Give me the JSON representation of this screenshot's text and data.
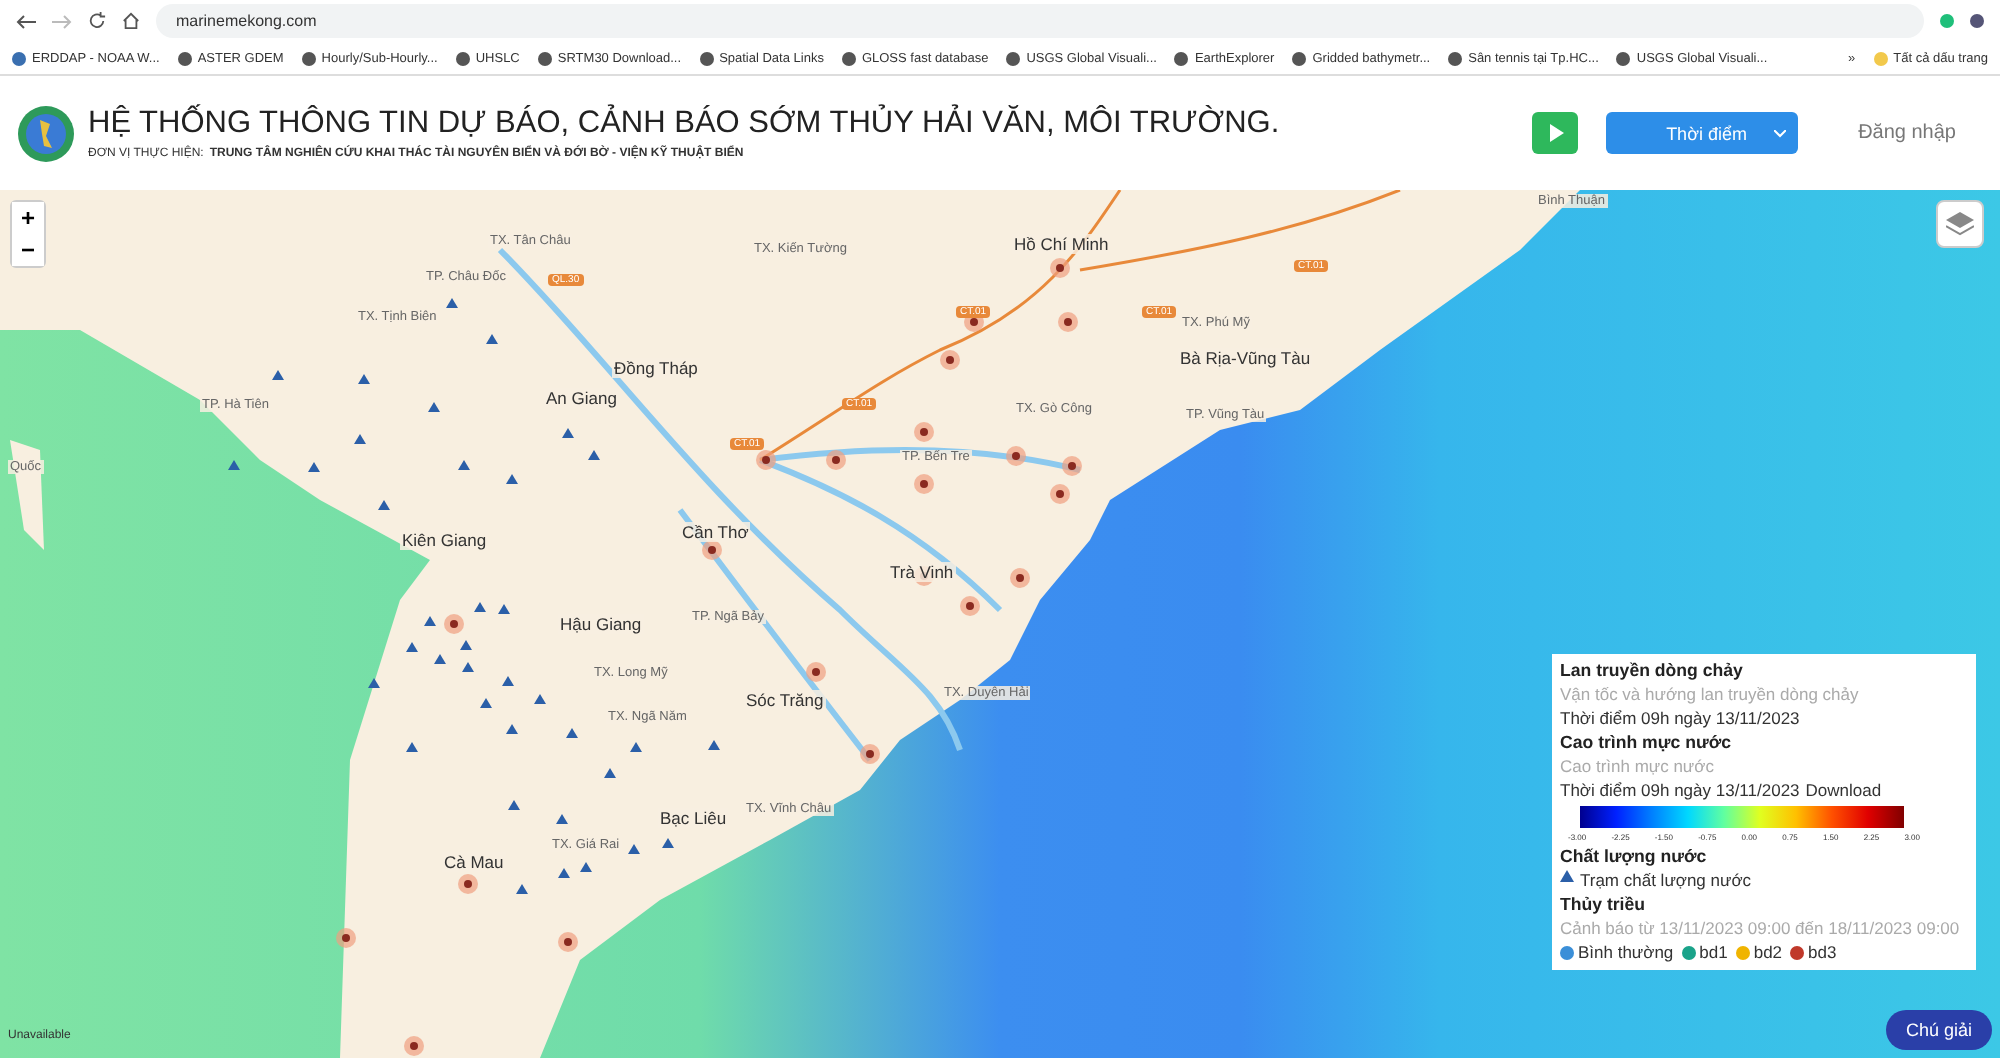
{
  "browser": {
    "url": "marinemekong.com",
    "bookmarks": [
      {
        "label": "ERDDAP - NOAA W..."
      },
      {
        "label": "ASTER GDEM"
      },
      {
        "label": "Hourly/Sub-Hourly..."
      },
      {
        "label": "UHSLC"
      },
      {
        "label": "SRTM30 Download..."
      },
      {
        "label": "Spatial Data Links"
      },
      {
        "label": "GLOSS fast database"
      },
      {
        "label": "USGS Global Visuali..."
      },
      {
        "label": "EarthExplorer"
      },
      {
        "label": "Gridded bathymetr..."
      },
      {
        "label": "Sân tennis tại Tp.HC..."
      },
      {
        "label": "USGS Global Visuali..."
      }
    ],
    "overflow": "»",
    "all_bookmarks": "Tất cả dấu trang"
  },
  "header": {
    "title": "HỆ THỐNG THÔNG TIN DỰ BÁO, CẢNH BÁO SỚM THỦY HẢI VĂN, MÔI TRƯỜNG.",
    "subtitle_label": "ĐƠN VỊ THỰC HIỆN:",
    "subtitle_org": "TRUNG TÂM NGHIÊN CỨU KHAI THÁC TÀI NGUYÊN BIỂN VÀ ĐỚI BỜ - VIỆN KỸ THUẬT BIỂN",
    "time_button": "Thời điểm",
    "login": "Đăng nhập"
  },
  "map": {
    "zoom_in": "+",
    "zoom_out": "−",
    "attribution": "Unavailable",
    "places": [
      {
        "name": "Bình Thuận"
      },
      {
        "name": "TX. Tân Châu"
      },
      {
        "name": "TX. Kiến Tường"
      },
      {
        "name": "Hồ Chí Minh"
      },
      {
        "name": "TP. Châu Đốc"
      },
      {
        "name": "TX. Tịnh Biên"
      },
      {
        "name": "TX. Phú Mỹ"
      },
      {
        "name": "Đồng Tháp"
      },
      {
        "name": "Bà Rịa-Vũng Tàu"
      },
      {
        "name": "TP. Hà Tiên"
      },
      {
        "name": "An Giang"
      },
      {
        "name": "TX. Gò Công"
      },
      {
        "name": "TP. Vũng Tàu"
      },
      {
        "name": "TP. Bến Tre"
      },
      {
        "name": "Quốc"
      },
      {
        "name": "Kiên Giang"
      },
      {
        "name": "Cần Thơ"
      },
      {
        "name": "Trà Vinh"
      },
      {
        "name": "Hậu Giang"
      },
      {
        "name": "TP. Ngã Bảy"
      },
      {
        "name": "TX. Long Mỹ"
      },
      {
        "name": "Sóc Trăng"
      },
      {
        "name": "TX. Duyên Hải"
      },
      {
        "name": "TX. Ngã Năm"
      },
      {
        "name": "Bạc Liêu"
      },
      {
        "name": "TX. Vĩnh Châu"
      },
      {
        "name": "TX. Giá Rai"
      },
      {
        "name": "Cà Mau"
      }
    ],
    "roads": [
      {
        "name": "CT.01"
      },
      {
        "name": "CT.01"
      },
      {
        "name": "CT.01"
      },
      {
        "name": "CT.01"
      },
      {
        "name": "CT.01"
      },
      {
        "name": "QL.30"
      }
    ]
  },
  "legend": {
    "flow": {
      "title": "Lan truyền dòng chảy",
      "subtitle": "Vận tốc và hướng lan truyền dòng chảy",
      "time": "Thời điểm 09h ngày 13/11/2023"
    },
    "water_level": {
      "title": "Cao trình mực nước",
      "subtitle": "Cao trình mực nước",
      "time": "Thời điểm 09h ngày 13/11/2023",
      "download": "Download",
      "ticks": [
        "-3.00",
        "-2.25",
        "-1.50",
        "-0.75",
        "0.00",
        "0.75",
        "1.50",
        "2.25",
        "3.00"
      ]
    },
    "quality": {
      "title": "Chất lượng nước",
      "station": "Trạm chất lượng nước"
    },
    "tide": {
      "title": "Thủy triều",
      "subtitle": "Cảnh báo từ 13/11/2023 09:00 đến 18/11/2023 09:00",
      "levels": [
        {
          "label": "Bình thường",
          "color": "#3b8fd8"
        },
        {
          "label": "bd1",
          "color": "#1aa38a"
        },
        {
          "label": "bd2",
          "color": "#f0b400"
        },
        {
          "label": "bd3",
          "color": "#c0392b"
        }
      ]
    }
  },
  "legend_button": "Chú giải"
}
